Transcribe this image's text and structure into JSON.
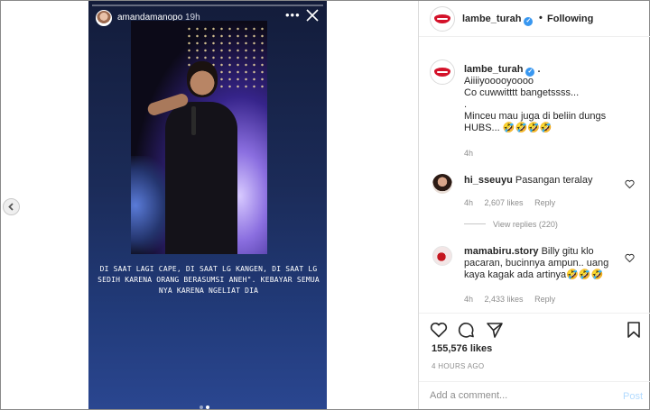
{
  "story": {
    "username": "amandamanopo",
    "time": "19h",
    "more_label": "•••",
    "caption": "DI SAAT LAGI CAPE, DI SAAT LG KANGEN, DI SAAT LG SEDIH KARENA ORANG BERASUMSI ANEH\". KEBAYAR SEMUA NYA KARENA NGELIAT DIA"
  },
  "header": {
    "username": "lambe_turah",
    "separator": "•",
    "follow_label": "Following"
  },
  "caption": {
    "username": "lambe_turah",
    "trail": ".",
    "text": "Aiiiiyooooyoooo\nCo cuwwitttt bangetssss...\n.\nMinceu mau juga di beliin dungs\nHUBS... 🤣🤣🤣🤣",
    "time": "4h"
  },
  "comments": [
    {
      "username": "hi_sseuyu",
      "text": "Pasangan teralay",
      "time": "4h",
      "likes": "2,607 likes",
      "reply": "Reply"
    },
    {
      "username": "mamabiru.story",
      "text": "Billy gitu klo pacaran, bucinnya ampun.. uang kaya kagak ada artinya🤣🤣🤣",
      "time": "4h",
      "likes": "2,433 likes",
      "reply": "Reply"
    }
  ],
  "view_replies": "View replies (220)",
  "likes": "155,576 likes",
  "ago": "4 HOURS AGO",
  "add_comment": {
    "placeholder": "Add a comment...",
    "post_label": "Post"
  },
  "colors": {
    "verified": "#3897f0",
    "lips": "#d4122a",
    "post": "#b3dbff"
  }
}
